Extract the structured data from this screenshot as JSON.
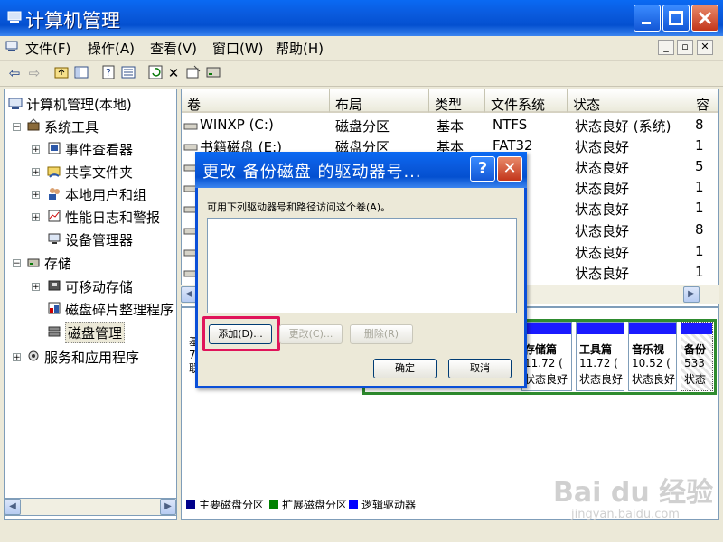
{
  "window": {
    "title": "计算机管理"
  },
  "menu": [
    "文件(F)",
    "操作(A)",
    "查看(V)",
    "窗口(W)",
    "帮助(H)"
  ],
  "tree": {
    "root": "计算机管理(本地)",
    "system_tools": "系统工具",
    "event_viewer": "事件查看器",
    "shared_folders": "共享文件夹",
    "local_users": "本地用户和组",
    "perf_logs": "性能日志和警报",
    "device_manager": "设备管理器",
    "storage": "存储",
    "removable_storage": "可移动存储",
    "defrag": "磁盘碎片整理程序",
    "disk_management": "磁盘管理",
    "services_apps": "服务和应用程序"
  },
  "table": {
    "columns": [
      "卷",
      "布局",
      "类型",
      "文件系统",
      "状态",
      "容"
    ],
    "rows": [
      [
        "WINXP (C:)",
        "磁盘分区",
        "基本",
        "NTFS",
        "状态良好 (系统)",
        "8"
      ],
      [
        "书籍磁盘 (E:)",
        "磁盘分区",
        "基本",
        "FAT32",
        "状态良好",
        "1"
      ],
      [
        "",
        "",
        "",
        "2",
        "状态良好",
        "5"
      ],
      [
        "",
        "",
        "",
        "2",
        "状态良好",
        "1"
      ],
      [
        "",
        "",
        "",
        "2",
        "状态良好",
        "1"
      ],
      [
        "",
        "",
        "",
        "2",
        "状态良好",
        "8"
      ],
      [
        "",
        "",
        "",
        "2",
        "状态良好",
        "1"
      ],
      [
        "",
        "",
        "",
        "2",
        "状态良好",
        "1"
      ]
    ]
  },
  "graphical": {
    "left_labels": [
      "基",
      "7",
      "联"
    ],
    "partitions": [
      {
        "name": "存储篇",
        "size": "11.72 (",
        "status": "状态良好"
      },
      {
        "name": "工具篇",
        "size": "11.72 (",
        "status": "状态良好"
      },
      {
        "name": "音乐视",
        "size": "10.52 (",
        "status": "状态良好"
      },
      {
        "name": "备份",
        "size": "533",
        "status": "状态"
      }
    ]
  },
  "legend": [
    {
      "label": "主要磁盘分区",
      "color": "#00008B"
    },
    {
      "label": "扩展磁盘分区",
      "color": "#008000"
    },
    {
      "label": "逻辑驱动器",
      "color": "#0000FF"
    }
  ],
  "dialog": {
    "title": "更改 备份磁盘 的驱动器号...",
    "help_glyph": "?",
    "close_glyph": "✕",
    "prompt": "可用下列驱动器号和路径访问这个卷(A)。",
    "add_button": "添加(D)...",
    "change_button": "更改(C)...",
    "remove_button": "删除(R)",
    "ok_button": "确定",
    "cancel_button": "取消"
  },
  "watermark": {
    "brand": "Bai du 经验",
    "url": "jingyan.baidu.com"
  }
}
